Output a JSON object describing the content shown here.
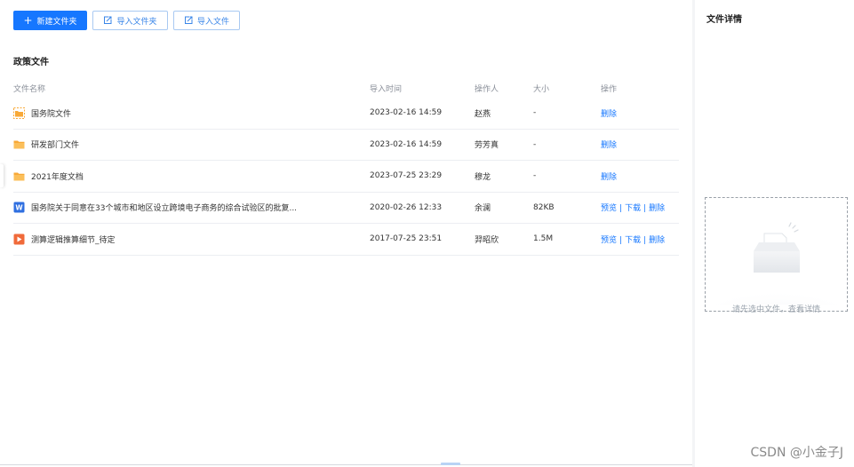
{
  "toolbar": {
    "new_folder": "新建文件夹",
    "import_folder": "导入文件夹",
    "import_file": "导入文件"
  },
  "section_title": "政策文件",
  "table": {
    "headers": {
      "name": "文件名称",
      "time": "导入时间",
      "operator": "操作人",
      "size": "大小",
      "actions": "操作"
    },
    "rows": [
      {
        "icon": "folder-selected-icon",
        "name": "国务院文件",
        "time": "2023-02-16 14:59",
        "operator": "赵燕",
        "size": "-",
        "actions": [
          "删除"
        ]
      },
      {
        "icon": "folder-icon",
        "name": "研发部门文件",
        "time": "2023-02-16 14:59",
        "operator": "劳芳真",
        "size": "-",
        "actions": [
          "删除"
        ]
      },
      {
        "icon": "folder-icon",
        "name": "2021年度文档",
        "time": "2023-07-25 23:29",
        "operator": "穆龙",
        "size": "-",
        "actions": [
          "删除"
        ]
      },
      {
        "icon": "word-file-icon",
        "name": "国务院关于同意在33个城市和地区设立跨境电子商务的综合试验区的批复...",
        "time": "2020-02-26 12:33",
        "operator": "余澜",
        "size": "82KB",
        "actions": [
          "预览",
          "下载",
          "删除"
        ]
      },
      {
        "icon": "ppt-file-icon",
        "name": "测算逻辑推算细节_待定",
        "time": "2017-07-25 23:51",
        "operator": "羿昭欣",
        "size": "1.5M",
        "actions": [
          "预览",
          "下载",
          "删除"
        ]
      }
    ]
  },
  "detail_panel": {
    "title": "文件详情",
    "empty_text": "请先选中文件，查看详情"
  },
  "watermark": "CSDN @小金子J",
  "colors": {
    "primary": "#1677ff",
    "folder": "#f8a937",
    "word": "#2f6fe0",
    "ppt": "#f06a3a"
  }
}
